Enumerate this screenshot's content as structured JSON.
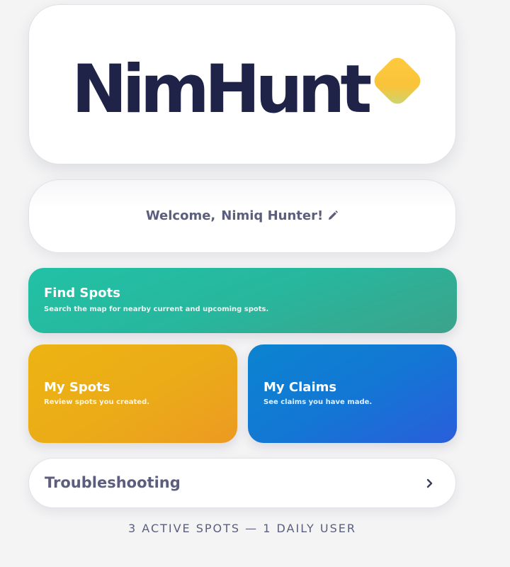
{
  "logo": {
    "wordmark": "NimHunt",
    "diamond_color": "#ffcb3d",
    "wordmark_color": "#1f2348"
  },
  "welcome": {
    "prefix": "Welcome,",
    "username": "Nimiq Hunter!",
    "edit_icon": "pencil-icon"
  },
  "tiles": {
    "find_spots": {
      "title": "Find Spots",
      "subtitle": "Search the map for nearby current and upcoming spots.",
      "color": "#22c1a5"
    },
    "my_spots": {
      "title": "My Spots",
      "subtitle": "Review spots you created.",
      "color": "#ecb412"
    },
    "my_claims": {
      "title": "My Claims",
      "subtitle": "See claims you have made.",
      "color": "#0b84d0"
    }
  },
  "troubleshooting": {
    "label": "Troubleshooting",
    "icon": "chevron-right-icon"
  },
  "footer": {
    "stats": "3 ACTIVE SPOTS — 1 DAILY USER"
  }
}
